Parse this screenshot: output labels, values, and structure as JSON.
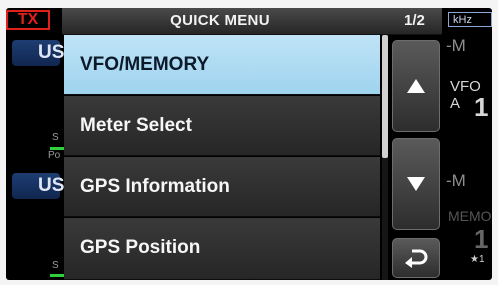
{
  "background": {
    "tx_label": "TX",
    "mode_top": "US",
    "mode_bottom": "US",
    "s_label_1": "S",
    "po_label": "Po",
    "s_label_2": "S",
    "khz_label": "kHz",
    "right_m_top": "-M",
    "vfo_label": "VFO A",
    "vfo_digit": "1",
    "right_m_bottom": "-M",
    "memo_label": "MEMO",
    "memo_digit": "1",
    "memo_star": "★1"
  },
  "menu": {
    "title": "QUICK MENU",
    "page": "1/2",
    "items": [
      {
        "label": "VFO/MEMORY",
        "selected": true
      },
      {
        "label": "Meter Select",
        "selected": false
      },
      {
        "label": "GPS Information",
        "selected": false
      },
      {
        "label": "GPS Position",
        "selected": false
      }
    ],
    "scroll_position": 0.5
  },
  "buttons": {
    "up_icon": "triangle-up-icon",
    "down_icon": "triangle-down-icon",
    "back_icon": "return-arrow-icon"
  },
  "colors": {
    "tx_red": "#e0201a",
    "selected_bg": "#aedbf2",
    "mode_blue": "#1e3d72",
    "meter_green": "#2ed13a"
  }
}
